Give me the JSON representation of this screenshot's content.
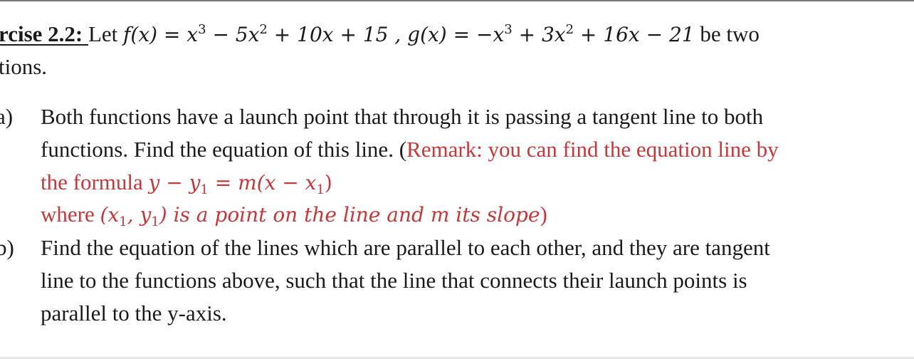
{
  "exercise": {
    "heading": "rcise 2.2: ",
    "intro_let": "Let ",
    "f_def": {
      "name": "f(x) = ",
      "terms": [
        "x",
        "3",
        " − 5x",
        "2",
        " + 10x + 15"
      ]
    },
    "separator": " , ",
    "g_def": {
      "name": "g(x) = ",
      "terms": [
        "−x",
        "3",
        " + 3x",
        "2",
        " + 16x − 21"
      ]
    },
    "intro_tail": " be two",
    "intro_line2": "tions."
  },
  "parts": [
    {
      "label": "a)",
      "lines": [
        "Both functions have a launch point that through it is passing a tangent line to both",
        "functions. Find the equation of this line. "
      ],
      "remark_open": "(",
      "remark_line1": "Remark: you can find the equation line by",
      "remark_line2_text": "the formula ",
      "remark_formula": {
        "lhs": "y − y",
        "lhs_sub": "1",
        "eq": " = m(x − x",
        "rhs_sub": "1",
        "close": ")"
      },
      "remark_line3_text": "where ",
      "remark_point": {
        "open": "(x",
        "sub1": "1",
        "mid": ", y",
        "sub2": "1",
        "close": ")"
      },
      "remark_line3_italic": " is a point on the line and  m its slope",
      "remark_close": ")"
    },
    {
      "label": "b)",
      "lines": [
        "Find the equation of the lines which are parallel to each other, and they are tangent",
        "line to the functions above, such that the line that connects their launch points is",
        "parallel to the y-axis."
      ]
    }
  ],
  "colors": {
    "text": "#1a1a1a",
    "remark_red": "#c0393b"
  }
}
